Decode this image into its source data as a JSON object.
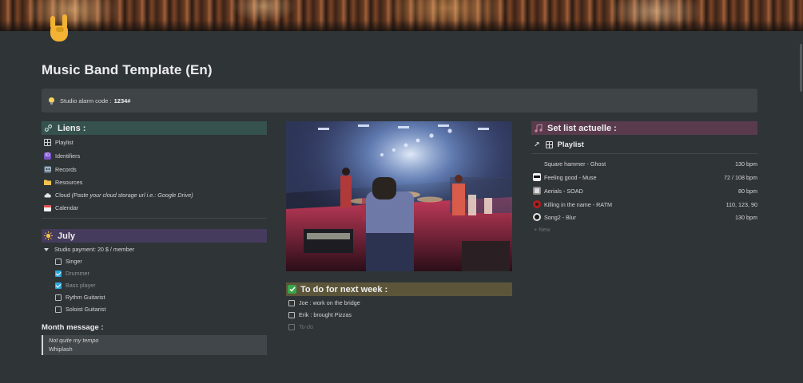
{
  "page": {
    "title": "Music Band Template (En)",
    "icon": "sign-of-horns-icon"
  },
  "callout": {
    "icon": "lightbulb-icon",
    "label": "Studio alarm code :",
    "value": "1234#"
  },
  "liens": {
    "heading": "Liens :",
    "icon": "link-icon",
    "items": [
      {
        "label": "Playlist",
        "icon": "table-icon",
        "note": ""
      },
      {
        "label": "Identifiers",
        "icon": "id-icon",
        "note": ""
      },
      {
        "label": "Records",
        "icon": "cassette-icon",
        "note": ""
      },
      {
        "label": "Resources",
        "icon": "folder-icon",
        "note": ""
      },
      {
        "label": "Cloud",
        "icon": "cloud-icon",
        "note": "(Paste your cloud storage url i.e.: Google Drive)"
      },
      {
        "label": "Calendar",
        "icon": "calendar-icon",
        "note": ""
      }
    ]
  },
  "july": {
    "heading": "July",
    "icon": "sun-icon",
    "toggle_label": "Studio payment: 20 $ / member",
    "checklist": [
      {
        "label": "Singer",
        "checked": false
      },
      {
        "label": "Drummer",
        "checked": true
      },
      {
        "label": "Bass player",
        "checked": true
      },
      {
        "label": "Rythm Guitarist",
        "checked": false
      },
      {
        "label": "Soloist Guitarist",
        "checked": false
      }
    ]
  },
  "month_message": {
    "heading": "Month message :",
    "line1": "Not quite my tempo",
    "line2": "Whiplash"
  },
  "todo": {
    "heading": "To do for next week :",
    "icon": "check-mark-icon",
    "items": [
      {
        "label": "Joe : work on the bridge",
        "checked": false,
        "placeholder": false
      },
      {
        "label": "Erik : brought Pizzas",
        "checked": false,
        "placeholder": false
      },
      {
        "label": "To-do",
        "checked": false,
        "placeholder": true
      }
    ]
  },
  "setlist": {
    "heading": "Set list actuelle :",
    "icon": "music-note-icon",
    "database_title": "Playlist",
    "new_label": "+ New",
    "songs": [
      {
        "title": "Square hammer - Ghost",
        "bpm": "130 bpm",
        "icon": ""
      },
      {
        "title": "Feeling good - Muse",
        "bpm": "72 / 108 bpm",
        "icon": "muse-album-icon"
      },
      {
        "title": "Aerials - SOAD",
        "bpm": "80 bpm",
        "icon": "soad-album-icon"
      },
      {
        "title": "Killing in the name - RATM",
        "bpm": "110, 123, 90",
        "icon": "ratm-album-icon"
      },
      {
        "title": "Song2 - Blur",
        "bpm": "130 bpm",
        "icon": "blur-album-icon"
      }
    ]
  },
  "colors": {
    "background": "#2f3437",
    "liens_header": "#35524f",
    "july_header": "#453b5c",
    "setlist_header": "#5a3b4e",
    "todo_header": "#5c5539",
    "checkbox_checked": "#2ea8e0"
  }
}
